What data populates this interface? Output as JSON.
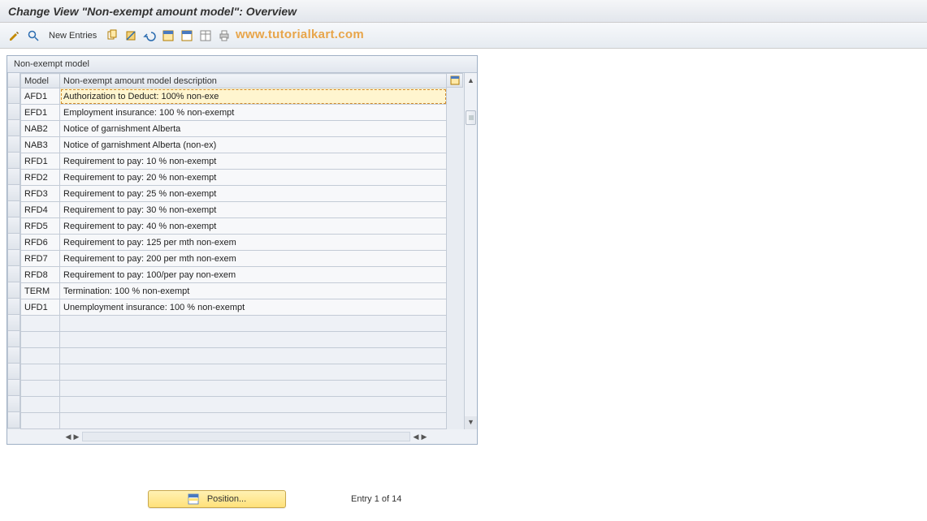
{
  "title": "Change View \"Non-exempt amount model\": Overview",
  "toolbar": {
    "new_entries_label": "New Entries"
  },
  "watermark": "www.tutorialkart.com",
  "panel": {
    "title": "Non-exempt model",
    "columns": {
      "model": "Model",
      "desc": "Non-exempt amount model description"
    }
  },
  "rows": [
    {
      "model": "AFD1",
      "desc": "Authorization to Deduct: 100% non-exe",
      "selected": true
    },
    {
      "model": "EFD1",
      "desc": "Employment insurance: 100 % non-exempt"
    },
    {
      "model": "NAB2",
      "desc": "Notice of garnishment Alberta"
    },
    {
      "model": "NAB3",
      "desc": "Notice of garnishment Alberta (non-ex)"
    },
    {
      "model": "RFD1",
      "desc": "Requirement to pay: 10 % non-exempt"
    },
    {
      "model": "RFD2",
      "desc": "Requirement to pay: 20 % non-exempt"
    },
    {
      "model": "RFD3",
      "desc": "Requirement to pay: 25 % non-exempt"
    },
    {
      "model": "RFD4",
      "desc": "Requirement to pay: 30 % non-exempt"
    },
    {
      "model": "RFD5",
      "desc": "Requirement to pay: 40 % non-exempt"
    },
    {
      "model": "RFD6",
      "desc": "Requirement to pay: 125 per mth non-exem"
    },
    {
      "model": "RFD7",
      "desc": "Requirement to pay: 200 per mth non-exem"
    },
    {
      "model": "RFD8",
      "desc": "Requirement to pay: 100/per pay non-exem"
    },
    {
      "model": "TERM",
      "desc": "Termination: 100 % non-exempt"
    },
    {
      "model": "UFD1",
      "desc": "Unemployment insurance: 100 % non-exempt"
    }
  ],
  "empty_rows": 7,
  "footer": {
    "position_label": "Position...",
    "entry_status": "Entry 1 of 14"
  }
}
